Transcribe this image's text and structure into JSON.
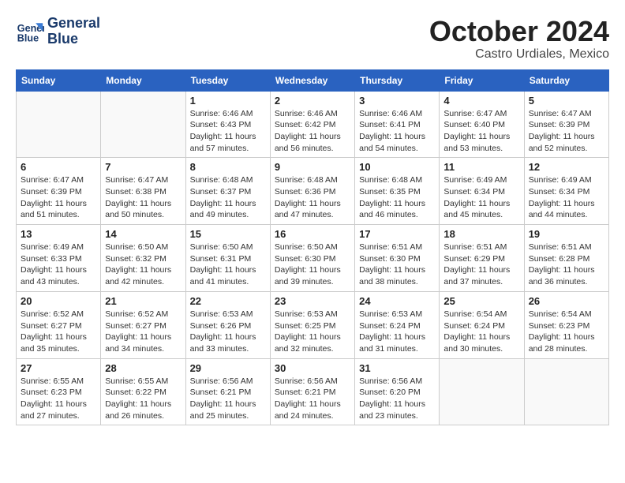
{
  "header": {
    "logo_line1": "General",
    "logo_line2": "Blue",
    "month": "October 2024",
    "location": "Castro Urdiales, Mexico"
  },
  "weekdays": [
    "Sunday",
    "Monday",
    "Tuesday",
    "Wednesday",
    "Thursday",
    "Friday",
    "Saturday"
  ],
  "weeks": [
    [
      {
        "day": "",
        "info": ""
      },
      {
        "day": "",
        "info": ""
      },
      {
        "day": "1",
        "info": "Sunrise: 6:46 AM\nSunset: 6:43 PM\nDaylight: 11 hours and 57 minutes."
      },
      {
        "day": "2",
        "info": "Sunrise: 6:46 AM\nSunset: 6:42 PM\nDaylight: 11 hours and 56 minutes."
      },
      {
        "day": "3",
        "info": "Sunrise: 6:46 AM\nSunset: 6:41 PM\nDaylight: 11 hours and 54 minutes."
      },
      {
        "day": "4",
        "info": "Sunrise: 6:47 AM\nSunset: 6:40 PM\nDaylight: 11 hours and 53 minutes."
      },
      {
        "day": "5",
        "info": "Sunrise: 6:47 AM\nSunset: 6:39 PM\nDaylight: 11 hours and 52 minutes."
      }
    ],
    [
      {
        "day": "6",
        "info": "Sunrise: 6:47 AM\nSunset: 6:39 PM\nDaylight: 11 hours and 51 minutes."
      },
      {
        "day": "7",
        "info": "Sunrise: 6:47 AM\nSunset: 6:38 PM\nDaylight: 11 hours and 50 minutes."
      },
      {
        "day": "8",
        "info": "Sunrise: 6:48 AM\nSunset: 6:37 PM\nDaylight: 11 hours and 49 minutes."
      },
      {
        "day": "9",
        "info": "Sunrise: 6:48 AM\nSunset: 6:36 PM\nDaylight: 11 hours and 47 minutes."
      },
      {
        "day": "10",
        "info": "Sunrise: 6:48 AM\nSunset: 6:35 PM\nDaylight: 11 hours and 46 minutes."
      },
      {
        "day": "11",
        "info": "Sunrise: 6:49 AM\nSunset: 6:34 PM\nDaylight: 11 hours and 45 minutes."
      },
      {
        "day": "12",
        "info": "Sunrise: 6:49 AM\nSunset: 6:34 PM\nDaylight: 11 hours and 44 minutes."
      }
    ],
    [
      {
        "day": "13",
        "info": "Sunrise: 6:49 AM\nSunset: 6:33 PM\nDaylight: 11 hours and 43 minutes."
      },
      {
        "day": "14",
        "info": "Sunrise: 6:50 AM\nSunset: 6:32 PM\nDaylight: 11 hours and 42 minutes."
      },
      {
        "day": "15",
        "info": "Sunrise: 6:50 AM\nSunset: 6:31 PM\nDaylight: 11 hours and 41 minutes."
      },
      {
        "day": "16",
        "info": "Sunrise: 6:50 AM\nSunset: 6:30 PM\nDaylight: 11 hours and 39 minutes."
      },
      {
        "day": "17",
        "info": "Sunrise: 6:51 AM\nSunset: 6:30 PM\nDaylight: 11 hours and 38 minutes."
      },
      {
        "day": "18",
        "info": "Sunrise: 6:51 AM\nSunset: 6:29 PM\nDaylight: 11 hours and 37 minutes."
      },
      {
        "day": "19",
        "info": "Sunrise: 6:51 AM\nSunset: 6:28 PM\nDaylight: 11 hours and 36 minutes."
      }
    ],
    [
      {
        "day": "20",
        "info": "Sunrise: 6:52 AM\nSunset: 6:27 PM\nDaylight: 11 hours and 35 minutes."
      },
      {
        "day": "21",
        "info": "Sunrise: 6:52 AM\nSunset: 6:27 PM\nDaylight: 11 hours and 34 minutes."
      },
      {
        "day": "22",
        "info": "Sunrise: 6:53 AM\nSunset: 6:26 PM\nDaylight: 11 hours and 33 minutes."
      },
      {
        "day": "23",
        "info": "Sunrise: 6:53 AM\nSunset: 6:25 PM\nDaylight: 11 hours and 32 minutes."
      },
      {
        "day": "24",
        "info": "Sunrise: 6:53 AM\nSunset: 6:24 PM\nDaylight: 11 hours and 31 minutes."
      },
      {
        "day": "25",
        "info": "Sunrise: 6:54 AM\nSunset: 6:24 PM\nDaylight: 11 hours and 30 minutes."
      },
      {
        "day": "26",
        "info": "Sunrise: 6:54 AM\nSunset: 6:23 PM\nDaylight: 11 hours and 28 minutes."
      }
    ],
    [
      {
        "day": "27",
        "info": "Sunrise: 6:55 AM\nSunset: 6:23 PM\nDaylight: 11 hours and 27 minutes."
      },
      {
        "day": "28",
        "info": "Sunrise: 6:55 AM\nSunset: 6:22 PM\nDaylight: 11 hours and 26 minutes."
      },
      {
        "day": "29",
        "info": "Sunrise: 6:56 AM\nSunset: 6:21 PM\nDaylight: 11 hours and 25 minutes."
      },
      {
        "day": "30",
        "info": "Sunrise: 6:56 AM\nSunset: 6:21 PM\nDaylight: 11 hours and 24 minutes."
      },
      {
        "day": "31",
        "info": "Sunrise: 6:56 AM\nSunset: 6:20 PM\nDaylight: 11 hours and 23 minutes."
      },
      {
        "day": "",
        "info": ""
      },
      {
        "day": "",
        "info": ""
      }
    ]
  ]
}
